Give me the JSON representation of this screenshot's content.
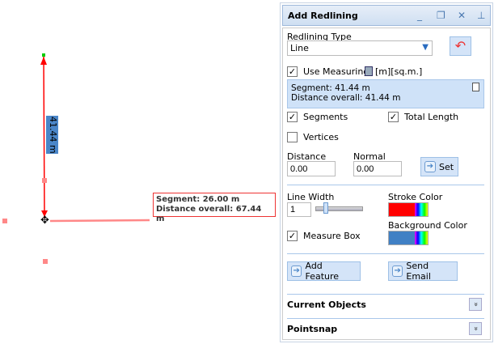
{
  "map": {
    "segment_label": "41.44 m",
    "tooltip": {
      "segment": "Segment: 26.00 m",
      "distance": "Distance overall: 67.44 m"
    }
  },
  "panel": {
    "title": "Add Redlining",
    "redlining_type_label": "Redlining Type",
    "redlining_type_value": "Line",
    "use_measuring_label": "Use Measuring",
    "units": "[m][sq.m.]",
    "info": {
      "segment": "Segment: 41.44 m",
      "distance": "Distance overall: 41.44 m"
    },
    "segments_label": "Segments",
    "total_length_label": "Total Length",
    "vertices_label": "Vertices",
    "distance_label": "Distance",
    "distance_value": "0.00",
    "normal_label": "Normal",
    "normal_value": "0.00",
    "set_label": "Set",
    "line_width_label": "Line Width",
    "line_width_value": "1",
    "stroke_color_label": "Stroke Color",
    "stroke_color": "#ff0000",
    "measure_box_label": "Measure Box",
    "background_color_label": "Background Color",
    "background_color": "#4080c4",
    "add_feature_label": "Add Feature",
    "send_email_label": "Send Email",
    "current_objects_label": "Current Objects",
    "pointsnap_label": "Pointsnap"
  }
}
